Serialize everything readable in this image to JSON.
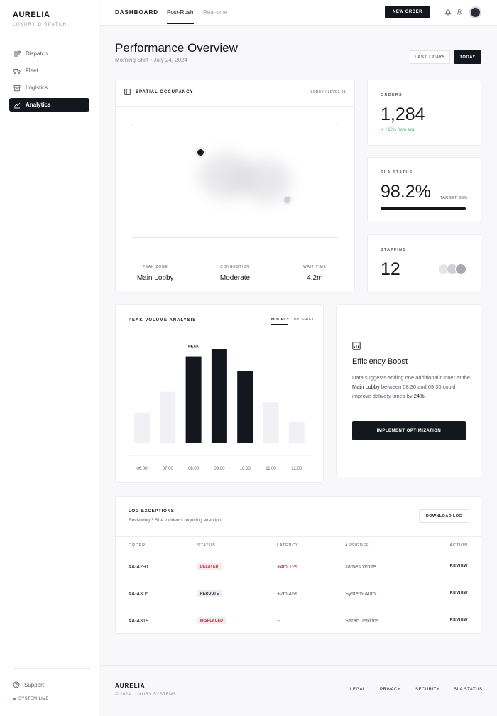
{
  "sidebar": {
    "brand": "AURELIA",
    "brand_sub": "LUXURY DISPATCH",
    "items": [
      {
        "label": "Dispatch"
      },
      {
        "label": "Fleet"
      },
      {
        "label": "Logistics"
      },
      {
        "label": "Analytics"
      }
    ],
    "support": "Support",
    "system_status": "SYSTEM LIVE"
  },
  "topbar": {
    "dashboard": "DASHBOARD",
    "tab_post_rush": "Post-Rush",
    "tab_real_time": "Real-time",
    "new_order": "NEW ORDER"
  },
  "header": {
    "title": "Performance Overview",
    "subtitle": "Morning Shift • July 24, 2024",
    "range_7d": "LAST 7 DAYS",
    "range_today": "TODAY"
  },
  "occupancy": {
    "title": "SPATIAL OCCUPANCY",
    "location": "LOBBY / LEVEL 01",
    "stats": [
      {
        "label": "PEAK ZONE",
        "value": "Main Lobby"
      },
      {
        "label": "CONGESTION",
        "value": "Moderate"
      },
      {
        "label": "WAIT TIME",
        "value": "4.2m"
      }
    ]
  },
  "kpis": {
    "orders": {
      "label": "ORDERS",
      "value": "1,284",
      "trend": "↗ +12% from avg"
    },
    "sla": {
      "label": "SLA STATUS",
      "value": "98.2%",
      "target": "TARGET: 95%",
      "progress": 0.982
    },
    "staffing": {
      "label": "STAFFING",
      "value": "12"
    }
  },
  "peak_volume": {
    "title": "PEAK VOLUME ANALYSIS",
    "tab_hourly": "HOURLY",
    "tab_shift": "BY SHIFT",
    "peak_label": "PEAK"
  },
  "chart_data": {
    "type": "bar",
    "title": "PEAK VOLUME ANALYSIS",
    "categories": [
      "06:00",
      "07:00",
      "08:00",
      "09:00",
      "10:00",
      "11:00",
      "12:00"
    ],
    "values": [
      32,
      54,
      92,
      100,
      76,
      43,
      22
    ],
    "highlighted": [
      false,
      false,
      true,
      true,
      true,
      false,
      false
    ],
    "annotations": [
      {
        "category": "08:00",
        "text": "PEAK"
      }
    ],
    "ylim": [
      0,
      100
    ]
  },
  "efficiency": {
    "title": "Efficiency Boost",
    "body_1": "Data suggests adding one additional runner at the ",
    "body_zone": "Main Lobby",
    "body_2": " between 08:30 and 09:30 could improve delivery times by ",
    "body_pct": "24%",
    "body_3": ".",
    "button": "IMPLEMENT OPTIMIZATION"
  },
  "log": {
    "title": "LOG EXCEPTIONS",
    "subtitle": "Reviewing 3 SLA incidents requiring attention",
    "download": "DOWNLOAD LOG",
    "columns": [
      "ORDER",
      "STATUS",
      "LATENCY",
      "ASSIGNEE",
      "ACTION"
    ],
    "rows": [
      {
        "order": "#A-4291",
        "status": "DELAYED",
        "latency": "+4m 12s",
        "assignee": "James White",
        "action": "REVIEW"
      },
      {
        "order": "#A-4305",
        "status": "REROUTE",
        "latency": "+2m 45s",
        "assignee": "System-Auto",
        "action": "REVIEW"
      },
      {
        "order": "#A-4318",
        "status": "MISPLACED",
        "latency": "--",
        "assignee": "Sarah Jenkins",
        "action": "REVIEW"
      }
    ]
  },
  "footer": {
    "brand": "AURELIA",
    "copyright": "© 2024 LUXURY SYSTEMS",
    "links": [
      "LEGAL",
      "PRIVACY",
      "SECURITY",
      "SLA STATUS"
    ]
  },
  "colors": {
    "primary": "#15171f",
    "positive": "#3bb36a",
    "alert": "#b01f3a",
    "muted_bar": "#f1f1f5"
  }
}
